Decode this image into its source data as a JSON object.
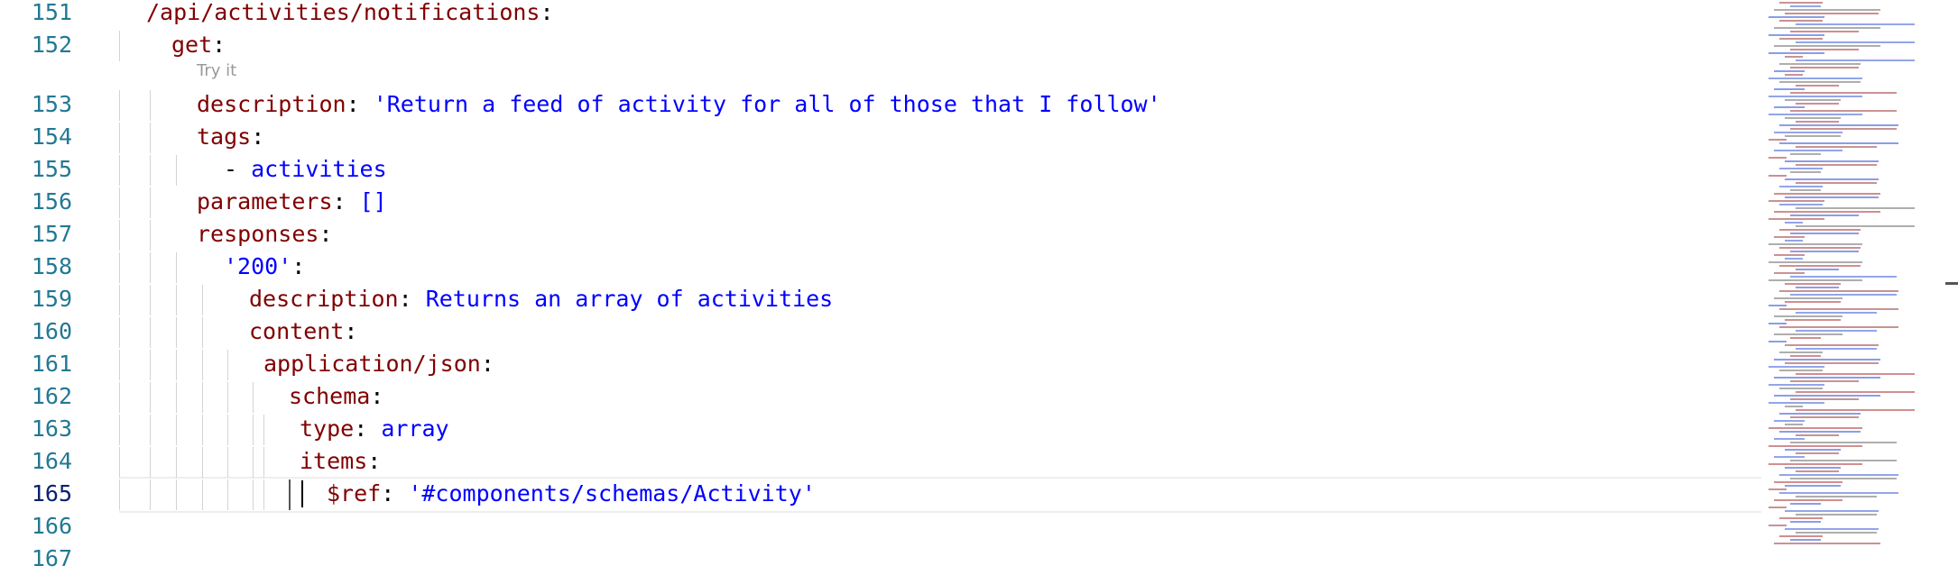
{
  "editor": {
    "codelens": "Try it",
    "lines": [
      {
        "num": "151",
        "tokens": [
          {
            "t": "/api/activities/notifications",
            "c": "key"
          },
          {
            "t": ":",
            "c": "punc"
          }
        ],
        "indent": 0
      },
      {
        "num": "152",
        "tokens": [
          {
            "t": "get",
            "c": "key"
          },
          {
            "t": ":",
            "c": "punc"
          }
        ],
        "indent": 1
      },
      {
        "num": "153",
        "tokens": [
          {
            "t": "description",
            "c": "key"
          },
          {
            "t": ": ",
            "c": "punc"
          },
          {
            "t": "'Return a feed of activity for all of those that I follow'",
            "c": "val"
          }
        ],
        "indent": 2
      },
      {
        "num": "154",
        "tokens": [
          {
            "t": "tags",
            "c": "key"
          },
          {
            "t": ":",
            "c": "punc"
          }
        ],
        "indent": 2
      },
      {
        "num": "155",
        "tokens": [
          {
            "t": "- ",
            "c": "punc"
          },
          {
            "t": "activities",
            "c": "val"
          }
        ],
        "indent": 3
      },
      {
        "num": "156",
        "tokens": [
          {
            "t": "parameters",
            "c": "key"
          },
          {
            "t": ": ",
            "c": "punc"
          },
          {
            "t": "[]",
            "c": "val"
          }
        ],
        "indent": 2
      },
      {
        "num": "157",
        "tokens": [
          {
            "t": "responses",
            "c": "key"
          },
          {
            "t": ":",
            "c": "punc"
          }
        ],
        "indent": 2
      },
      {
        "num": "158",
        "tokens": [
          {
            "t": "'200'",
            "c": "val"
          },
          {
            "t": ":",
            "c": "punc"
          }
        ],
        "indent": 3
      },
      {
        "num": "159",
        "tokens": [
          {
            "t": "description",
            "c": "key"
          },
          {
            "t": ": ",
            "c": "punc"
          },
          {
            "t": "Returns an array of activities",
            "c": "val"
          }
        ],
        "indent": 4
      },
      {
        "num": "160",
        "tokens": [
          {
            "t": "content",
            "c": "key"
          },
          {
            "t": ":",
            "c": "punc"
          }
        ],
        "indent": 4
      },
      {
        "num": "161",
        "tokens": [
          {
            "t": "application/json",
            "c": "key"
          },
          {
            "t": ":",
            "c": "punc"
          }
        ],
        "indent": 5
      },
      {
        "num": "162",
        "tokens": [
          {
            "t": "schema",
            "c": "key"
          },
          {
            "t": ":",
            "c": "punc"
          }
        ],
        "indent": 6
      },
      {
        "num": "163",
        "tokens": [
          {
            "t": "type",
            "c": "key"
          },
          {
            "t": ": ",
            "c": "punc"
          },
          {
            "t": "array",
            "c": "val"
          }
        ],
        "indent": 7
      },
      {
        "num": "164",
        "tokens": [
          {
            "t": "items",
            "c": "key"
          },
          {
            "t": ":",
            "c": "punc"
          }
        ],
        "indent": 7
      },
      {
        "num": "165",
        "tokens": [
          {
            "t": "$ref",
            "c": "key"
          },
          {
            "t": ": ",
            "c": "punc"
          },
          {
            "t": "'#components/schemas/Activity'",
            "c": "val"
          }
        ],
        "indent": 8,
        "active": true
      },
      {
        "num": "166",
        "tokens": [],
        "indent": 0
      },
      {
        "num": "167",
        "tokens": [],
        "indent": 0
      }
    ]
  }
}
